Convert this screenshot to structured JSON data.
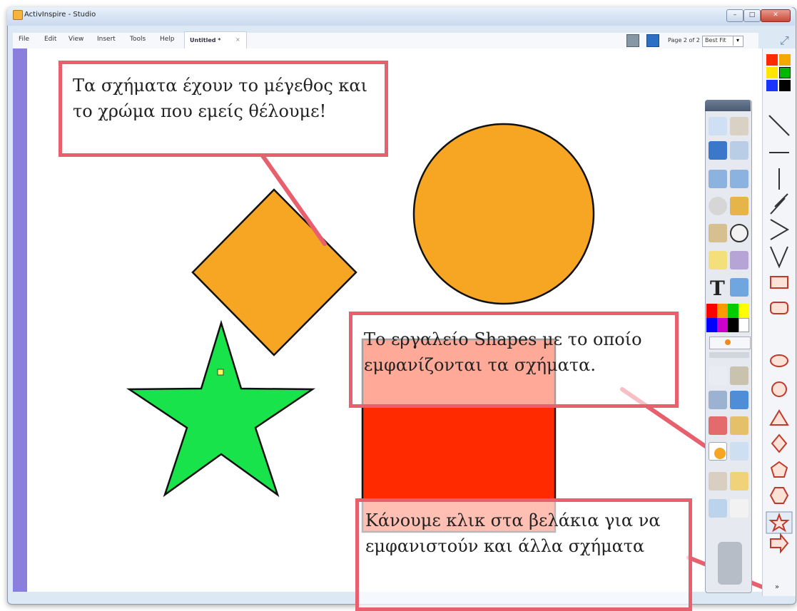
{
  "window": {
    "title": "ActivInspire - Studio",
    "controls": {
      "minimize": "–",
      "maximize": "□",
      "close": "✕"
    }
  },
  "menubar": {
    "items": [
      "File",
      "Edit",
      "View",
      "Insert",
      "Tools",
      "Help"
    ],
    "tab_label": "Untitled *",
    "tab_close": "×",
    "page_indicator": "Page 2 of 2",
    "zoom_value": "Best Fit",
    "zoom_arrow": "▾"
  },
  "callouts": {
    "top": "Τα σχήματα έχουν το μέγεθος και το χρώμα που εμείς θέλουμε!",
    "middle": "Το εργαλείο Shapes με το οποίο εμφανίζονται τα σχήματα.",
    "bottom": "Κάνουμε κλικ στα βελάκια για να εμφανιστούν και άλλα σχήματα"
  },
  "canvas_shapes": [
    "orange-diamond",
    "orange-circle",
    "green-star",
    "red-square"
  ],
  "right_bar": {
    "colors": [
      "#ff2a00",
      "#f5a800",
      "#00b800",
      "#ffe600",
      "#1a33ff",
      "#000000"
    ],
    "tools": [
      "line-icon",
      "horizontal-line-icon",
      "vertical-line-icon",
      "zigzag-icon",
      "chevron-icon",
      "rectangle-icon",
      "rounded-rectangle-icon",
      "ellipse-icon",
      "circle-icon",
      "triangle-icon",
      "diamond-icon",
      "pentagon-icon",
      "hexagon-icon",
      "star-icon",
      "arrow-icon"
    ],
    "more_arrow": "»"
  },
  "toolbox": {
    "text_tool": "T",
    "palette": [
      "#ff0000",
      "#ff9900",
      "#00cc00",
      "#ffff00",
      "#0000ff",
      "#cc00cc",
      "#000000",
      "#ffffff"
    ]
  },
  "colors": {
    "callout_border": "#e8606d",
    "shape_orange": "#f6a623",
    "shape_green": "#19e34a",
    "shape_red": "#ff2a00"
  }
}
